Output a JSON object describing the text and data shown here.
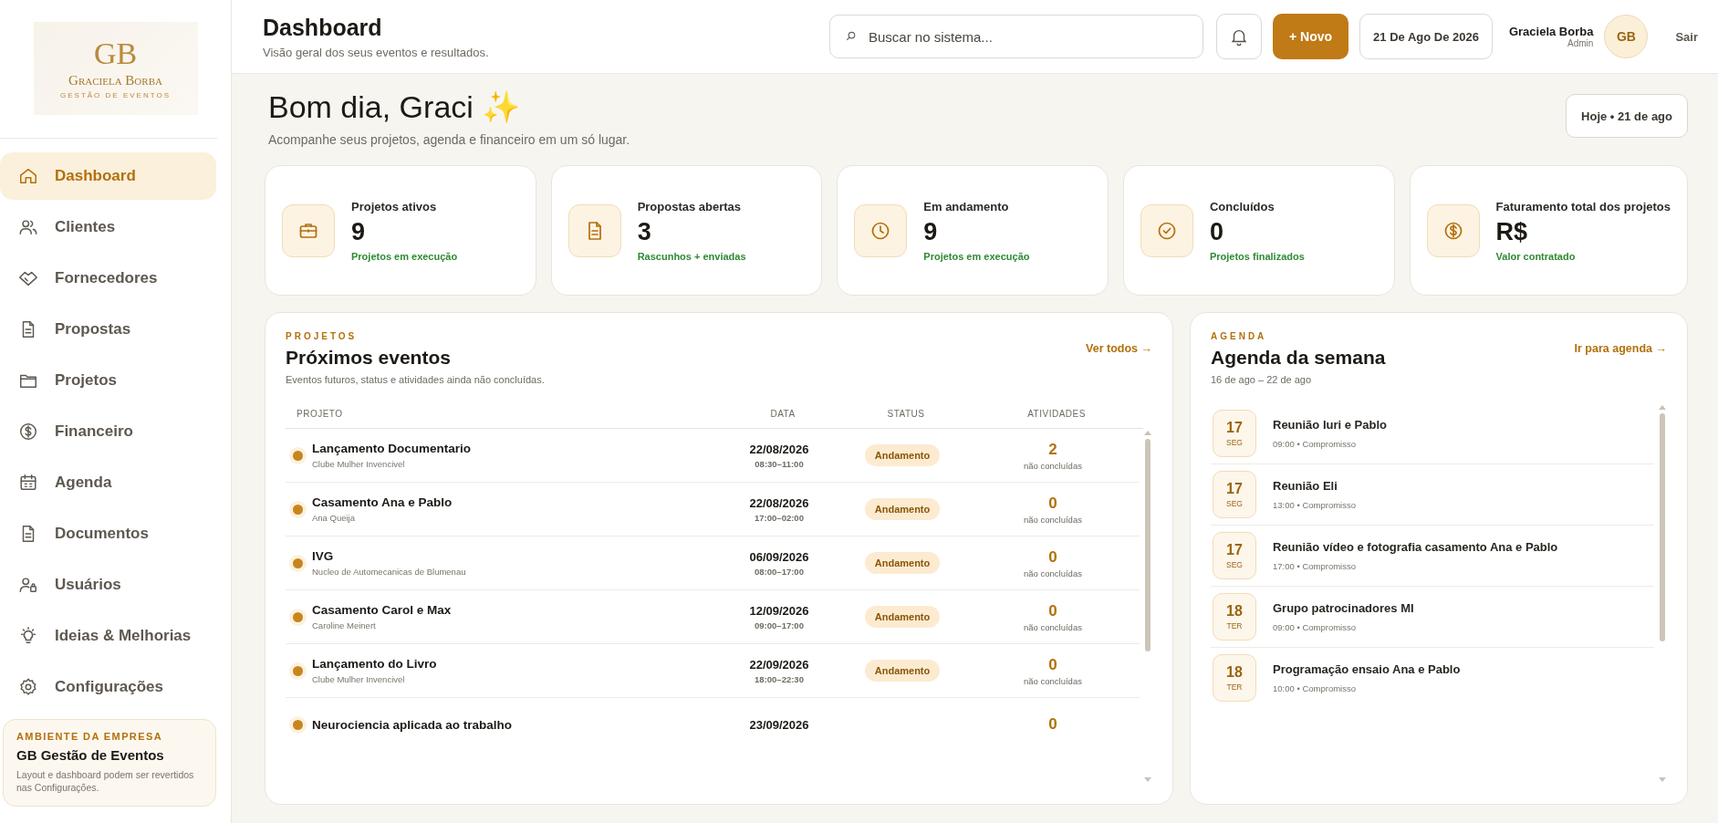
{
  "sidebar": {
    "logo": {
      "monogram": "GB",
      "name": "Graciela Borba",
      "tagline": "GESTÃO DE EVENTOS"
    },
    "items": [
      {
        "label": "Dashboard",
        "kind": "home",
        "selected": true
      },
      {
        "label": "Clientes",
        "kind": "users",
        "selected": false
      },
      {
        "label": "Fornecedores",
        "kind": "handshake",
        "selected": false
      },
      {
        "label": "Propostas",
        "kind": "document",
        "selected": false
      },
      {
        "label": "Projetos",
        "kind": "folder",
        "selected": false
      },
      {
        "label": "Financeiro",
        "kind": "dollar",
        "selected": false
      },
      {
        "label": "Agenda",
        "kind": "calendar",
        "selected": false
      },
      {
        "label": "Documentos",
        "kind": "document",
        "selected": false
      },
      {
        "label": "Usuários",
        "kind": "userlock",
        "selected": false
      },
      {
        "label": "Ideias & Melhorias",
        "kind": "bulb",
        "selected": false
      },
      {
        "label": "Configurações",
        "kind": "gear",
        "selected": false
      }
    ],
    "company": {
      "label": "AMBIENTE DA EMPRESA",
      "name": "GB Gestão de Eventos",
      "note": "Layout e dashboard podem ser revertidos nas Configurações."
    }
  },
  "header": {
    "title": "Dashboard",
    "subtitle": "Visão geral dos seus eventos e resultados.",
    "search": {
      "placeholder": "Buscar no sistema..."
    },
    "new_button": "+ Novo",
    "date": "21 De Ago De 2026",
    "user": {
      "name": "Graciela Borba",
      "role": "Admin",
      "initials": "GB"
    },
    "logout": "Sair"
  },
  "greeting": {
    "title": "Bom dia, Graci ✨",
    "subtitle": "Acompanhe seus projetos, agenda e financeiro em um só lugar.",
    "today_button": "Hoje • 21 de ago"
  },
  "stats": [
    {
      "kind": "briefcase",
      "label": "Projetos ativos",
      "value": "9",
      "note": "Projetos em execução"
    },
    {
      "kind": "document",
      "label": "Propostas abertas",
      "value": "3",
      "note": "Rascunhos + enviadas"
    },
    {
      "kind": "clock",
      "label": "Em andamento",
      "value": "9",
      "note": "Projetos em execução"
    },
    {
      "kind": "check",
      "label": "Concluídos",
      "value": "0",
      "note": "Projetos finalizados"
    },
    {
      "kind": "dollar",
      "label": "Faturamento total dos projetos",
      "value": "R$",
      "note": "Valor contratado"
    }
  ],
  "projects": {
    "eyebrow": "PROJETOS",
    "title": "Próximos eventos",
    "description": "Eventos futuros, status e atividades ainda não concluídas.",
    "link": "Ver todos →",
    "columns": [
      "PROJETO",
      "DATA",
      "STATUS",
      "ATIVIDADES"
    ],
    "rows": [
      {
        "name": "Lançamento Documentario",
        "client": "Clube Mulher Invencivel",
        "date": "22/08/2026",
        "time": "08:30–11:00",
        "status": "Andamento",
        "activities": "2",
        "activities_note": "não concluídas"
      },
      {
        "name": "Casamento Ana e Pablo",
        "client": "Ana Queija",
        "date": "22/08/2026",
        "time": "17:00–02:00",
        "status": "Andamento",
        "activities": "0",
        "activities_note": "não concluídas"
      },
      {
        "name": "IVG",
        "client": "Nucleo de Automecanicas de Blumenau",
        "date": "06/09/2026",
        "time": "08:00–17:00",
        "status": "Andamento",
        "activities": "0",
        "activities_note": "não concluídas"
      },
      {
        "name": "Casamento Carol e Max",
        "client": "Caroline Meinert",
        "date": "12/09/2026",
        "time": "09:00–17:00",
        "status": "Andamento",
        "activities": "0",
        "activities_note": "não concluídas"
      },
      {
        "name": "Lançamento do Livro",
        "client": "Clube Mulher Invencivel",
        "date": "22/09/2026",
        "time": "18:00–22:30",
        "status": "Andamento",
        "activities": "0",
        "activities_note": "não concluídas"
      },
      {
        "name": "Neurociencia aplicada ao trabalho",
        "date": "23/09/2026",
        "activities": "0"
      }
    ]
  },
  "agenda": {
    "eyebrow": "AGENDA",
    "title": "Agenda da semana",
    "range": "16 de ago – 22 de ago",
    "link": "Ir para agenda →",
    "items": [
      {
        "day": "17",
        "weekday": "SEG",
        "title": "Reunião Iuri e Pablo",
        "meta": "09:00 • Compromisso"
      },
      {
        "day": "17",
        "weekday": "SEG",
        "title": "Reunião Eli",
        "meta": "13:00 • Compromisso"
      },
      {
        "day": "17",
        "weekday": "SEG",
        "title": "Reunião vídeo e fotografia casamento Ana e Pablo",
        "meta": "17:00 • Compromisso"
      },
      {
        "day": "18",
        "weekday": "TER",
        "title": "Grupo patrocinadores MI",
        "meta": "09:00 • Compromisso"
      },
      {
        "day": "18",
        "weekday": "TER",
        "title": "Programação ensaio Ana e Pablo",
        "meta": "10:00 • Compromisso"
      }
    ]
  }
}
